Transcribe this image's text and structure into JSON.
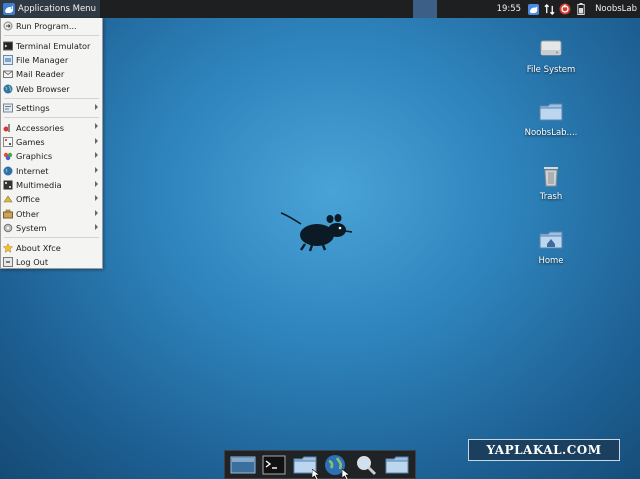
{
  "top_panel": {
    "apps_menu_label": "Applications Menu",
    "clock": "19:55",
    "user": "NoobsLab"
  },
  "app_menu": {
    "groups": [
      [
        {
          "label": "Run Program...",
          "icon": "run-icon"
        }
      ],
      [
        {
          "label": "Terminal Emulator",
          "icon": "terminal-icon"
        },
        {
          "label": "File Manager",
          "icon": "file-manager-icon"
        },
        {
          "label": "Mail Reader",
          "icon": "mail-icon"
        },
        {
          "label": "Web Browser",
          "icon": "globe-icon"
        }
      ],
      [
        {
          "label": "Settings",
          "icon": "settings-icon",
          "submenu": true
        }
      ],
      [
        {
          "label": "Accessories",
          "icon": "accessories-icon",
          "submenu": true
        },
        {
          "label": "Games",
          "icon": "games-icon",
          "submenu": true
        },
        {
          "label": "Graphics",
          "icon": "graphics-icon",
          "submenu": true
        },
        {
          "label": "Internet",
          "icon": "internet-icon",
          "submenu": true
        },
        {
          "label": "Multimedia",
          "icon": "multimedia-icon",
          "submenu": true
        },
        {
          "label": "Office",
          "icon": "office-icon",
          "submenu": true
        },
        {
          "label": "Other",
          "icon": "other-icon",
          "submenu": true
        },
        {
          "label": "System",
          "icon": "system-icon",
          "submenu": true
        }
      ],
      [
        {
          "label": "About Xfce",
          "icon": "star-icon"
        },
        {
          "label": "Log Out",
          "icon": "logout-icon"
        }
      ]
    ]
  },
  "desktop_icons": [
    {
      "label": "File System",
      "icon": "drive-icon"
    },
    {
      "label": "NoobsLab....",
      "icon": "folder-icon"
    },
    {
      "label": "Trash",
      "icon": "trash-icon"
    },
    {
      "label": "Home",
      "icon": "home-folder-icon"
    }
  ],
  "dock": [
    "desktop-icon",
    "terminal-icon",
    "folder-icon",
    "globe-icon",
    "search-icon",
    "folder-icon"
  ],
  "watermark": "YAPLAKAL.COM",
  "colors": {
    "panel": "#1d1f21",
    "menu_bg": "#f4f4f3",
    "desktop_accent": "#2f86bf"
  }
}
